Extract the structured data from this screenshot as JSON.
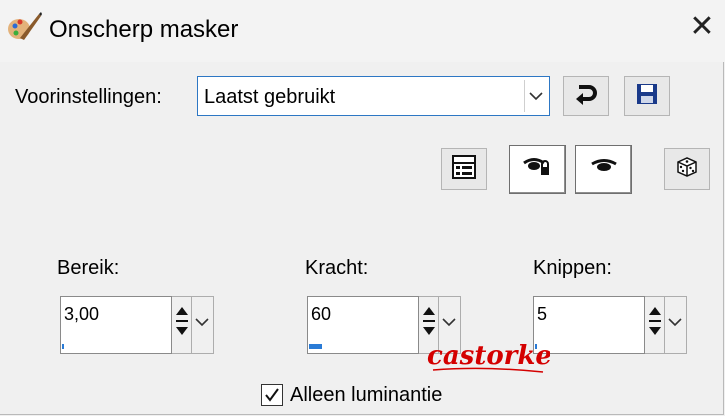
{
  "window": {
    "title": "Onscherp masker",
    "close_glyph": "✕"
  },
  "presets": {
    "label": "Voorinstellingen:",
    "selected": "Laatst gebruikt"
  },
  "fields": [
    {
      "label": "Bereik:",
      "value": "3,00",
      "level": 0.02
    },
    {
      "label": "Kracht:",
      "value": "60",
      "level": 0.12
    },
    {
      "label": "Knippen:",
      "value": "5",
      "level": 0.0
    }
  ],
  "luminance_checkbox": {
    "label": "Alleen luminantie",
    "checked": true
  },
  "watermark": {
    "text": "castorke",
    "color": "#d40000"
  },
  "icons": {
    "title": "paint-brush-icon",
    "reset": "undo-arrow-icon",
    "save": "floppy-disk-icon",
    "layout": "layout-panel-icon",
    "proof_auto": "eye-auto-proof-icon",
    "proof": "eye-proof-icon",
    "randomize": "dice-icon"
  }
}
